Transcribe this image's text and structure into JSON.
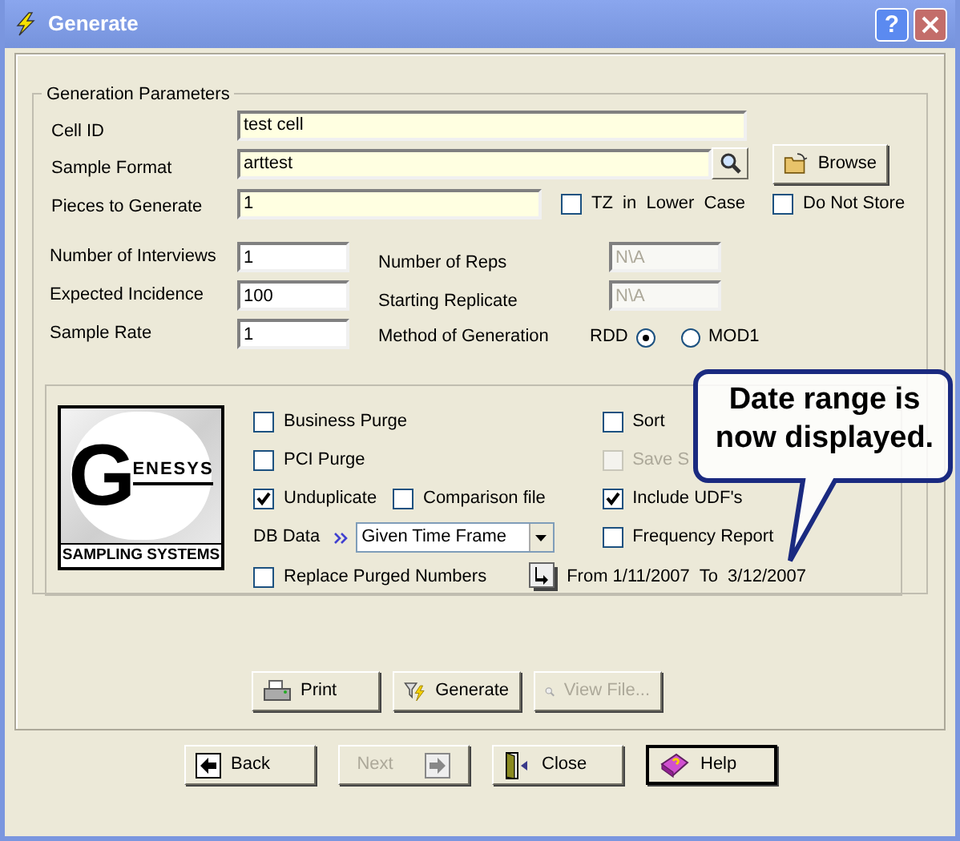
{
  "window": {
    "title": "Generate",
    "help_button": "?"
  },
  "group": {
    "title": "Generation Parameters"
  },
  "cell_id": {
    "label": "Cell ID",
    "value": "test cell"
  },
  "sample_format": {
    "label": "Sample Format",
    "value": "arttest",
    "browse": "Browse"
  },
  "pieces": {
    "label": "Pieces to Generate",
    "value": "1"
  },
  "tz_lower": {
    "label": "TZ  in  Lower  Case",
    "checked": false
  },
  "do_not_store": {
    "label": "Do Not Store",
    "checked": false
  },
  "left_fields": [
    {
      "label": "Number of Interviews",
      "value": "1"
    },
    {
      "label": "Expected Incidence",
      "value": "100"
    },
    {
      "label": "Sample Rate",
      "value": "1"
    }
  ],
  "right_fields": [
    {
      "label": "Number of Reps",
      "value": "N\\A",
      "disabled": true
    },
    {
      "label": "Starting Replicate",
      "value": "N\\A",
      "disabled": true
    }
  ],
  "method": {
    "label": "Method of Generation",
    "options": [
      {
        "label": "RDD",
        "selected": true
      },
      {
        "label": "MOD1",
        "selected": false
      }
    ]
  },
  "logo": {
    "letter": "G",
    "word": "ENESYS",
    "tagline": "SAMPLING SYSTEMS"
  },
  "left_options": [
    {
      "label": "Business Purge",
      "checked": false
    },
    {
      "label": "PCI Purge",
      "checked": false
    },
    {
      "label": "Unduplicate",
      "checked": true
    },
    {
      "label": "Comparison file",
      "checked": false
    },
    {
      "label": "Replace Purged Numbers",
      "checked": false
    }
  ],
  "db_data": {
    "label": "DB Data",
    "value": "Given Time Frame"
  },
  "right_options": [
    {
      "label": "Sort",
      "checked": false,
      "disabled": false
    },
    {
      "label": "Save S",
      "checked": false,
      "disabled": true
    },
    {
      "label": "Include UDF's",
      "checked": true,
      "disabled": false
    },
    {
      "label": "Frequency Report",
      "checked": false,
      "disabled": false
    }
  ],
  "date_range": "From 1/11/2007  To  3/12/2007",
  "callout": "Date range is now displayed.",
  "action_buttons": [
    {
      "kind": "print",
      "label": "Print",
      "disabled": false
    },
    {
      "kind": "generate",
      "label": "Generate",
      "disabled": false
    },
    {
      "kind": "view",
      "label": "View File...",
      "disabled": true
    }
  ],
  "nav_buttons": [
    {
      "kind": "back",
      "label": "Back",
      "disabled": false,
      "default": false
    },
    {
      "kind": "next",
      "label": "Next",
      "disabled": true,
      "default": false
    },
    {
      "kind": "close",
      "label": "Close",
      "disabled": false,
      "default": false
    },
    {
      "kind": "help",
      "label": "Help",
      "disabled": false,
      "default": true
    }
  ]
}
